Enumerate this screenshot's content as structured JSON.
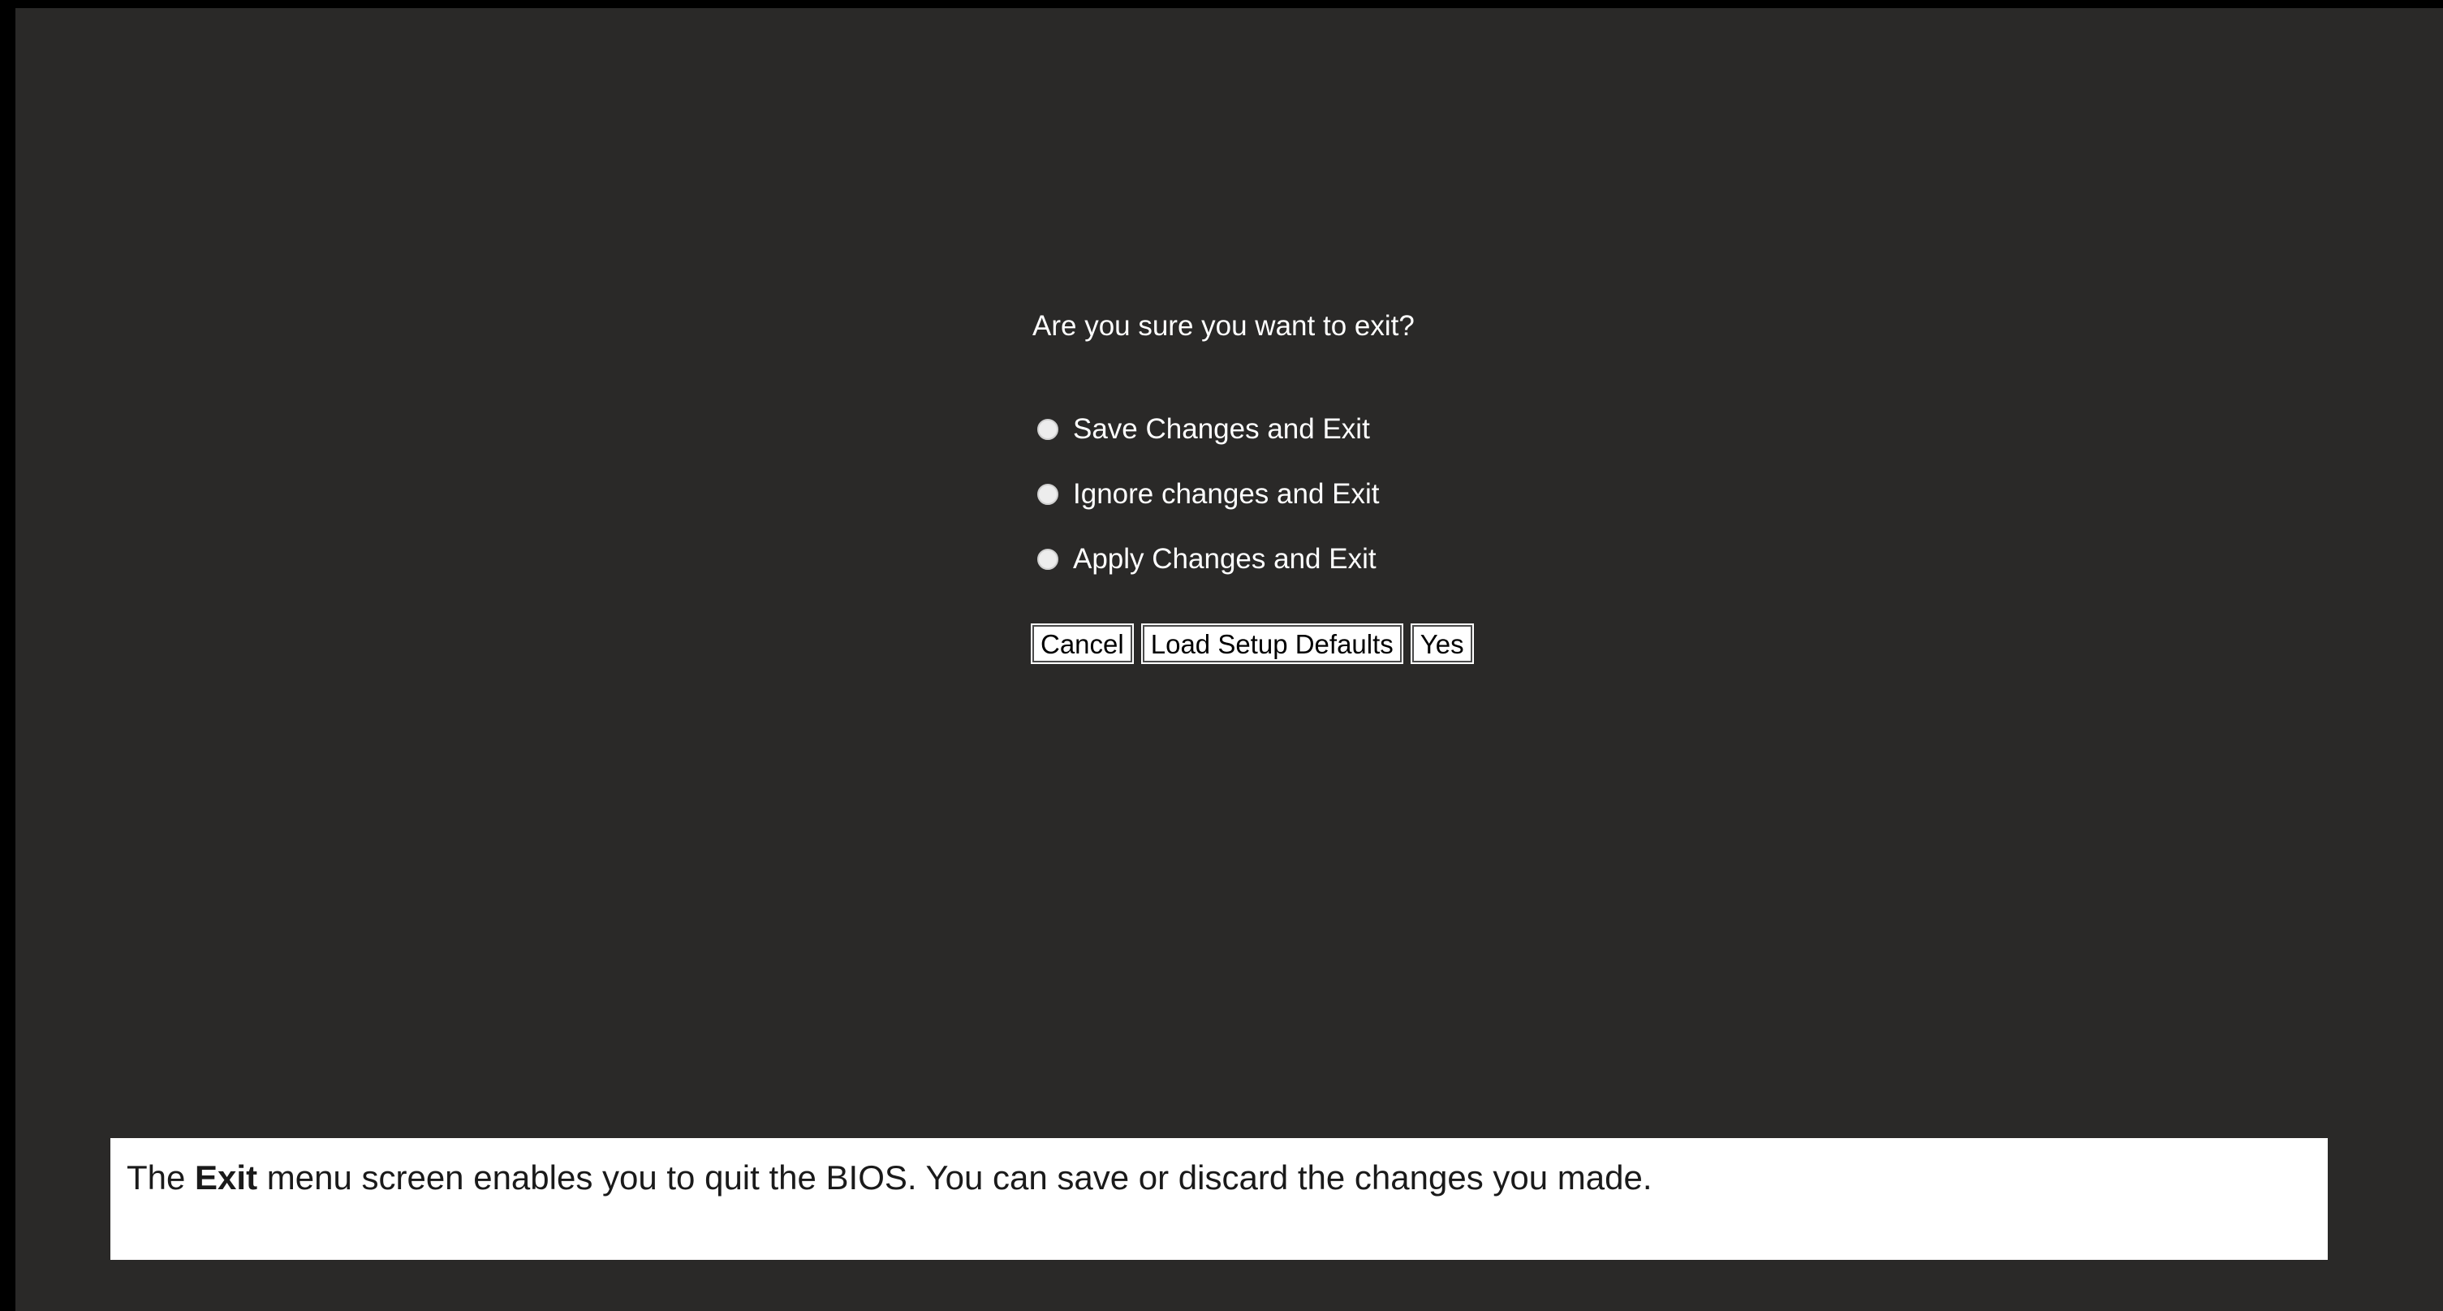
{
  "dialog": {
    "question": "Are you sure you want to exit?",
    "options": [
      {
        "label": "Save Changes and Exit",
        "selected": false
      },
      {
        "label": "Ignore changes and Exit",
        "selected": false
      },
      {
        "label": "Apply Changes and Exit",
        "selected": false
      }
    ],
    "buttons": {
      "cancel": "Cancel",
      "load_defaults": "Load Setup Defaults",
      "yes": "Yes"
    }
  },
  "help": {
    "prefix": "The ",
    "keyword": "Exit",
    "suffix": " menu screen enables you to quit the BIOS. You can save or discard the changes you made."
  },
  "colors": {
    "background": "#2a2928",
    "border": "#000000",
    "text": "#ffffff",
    "help_background": "#ffffff"
  }
}
